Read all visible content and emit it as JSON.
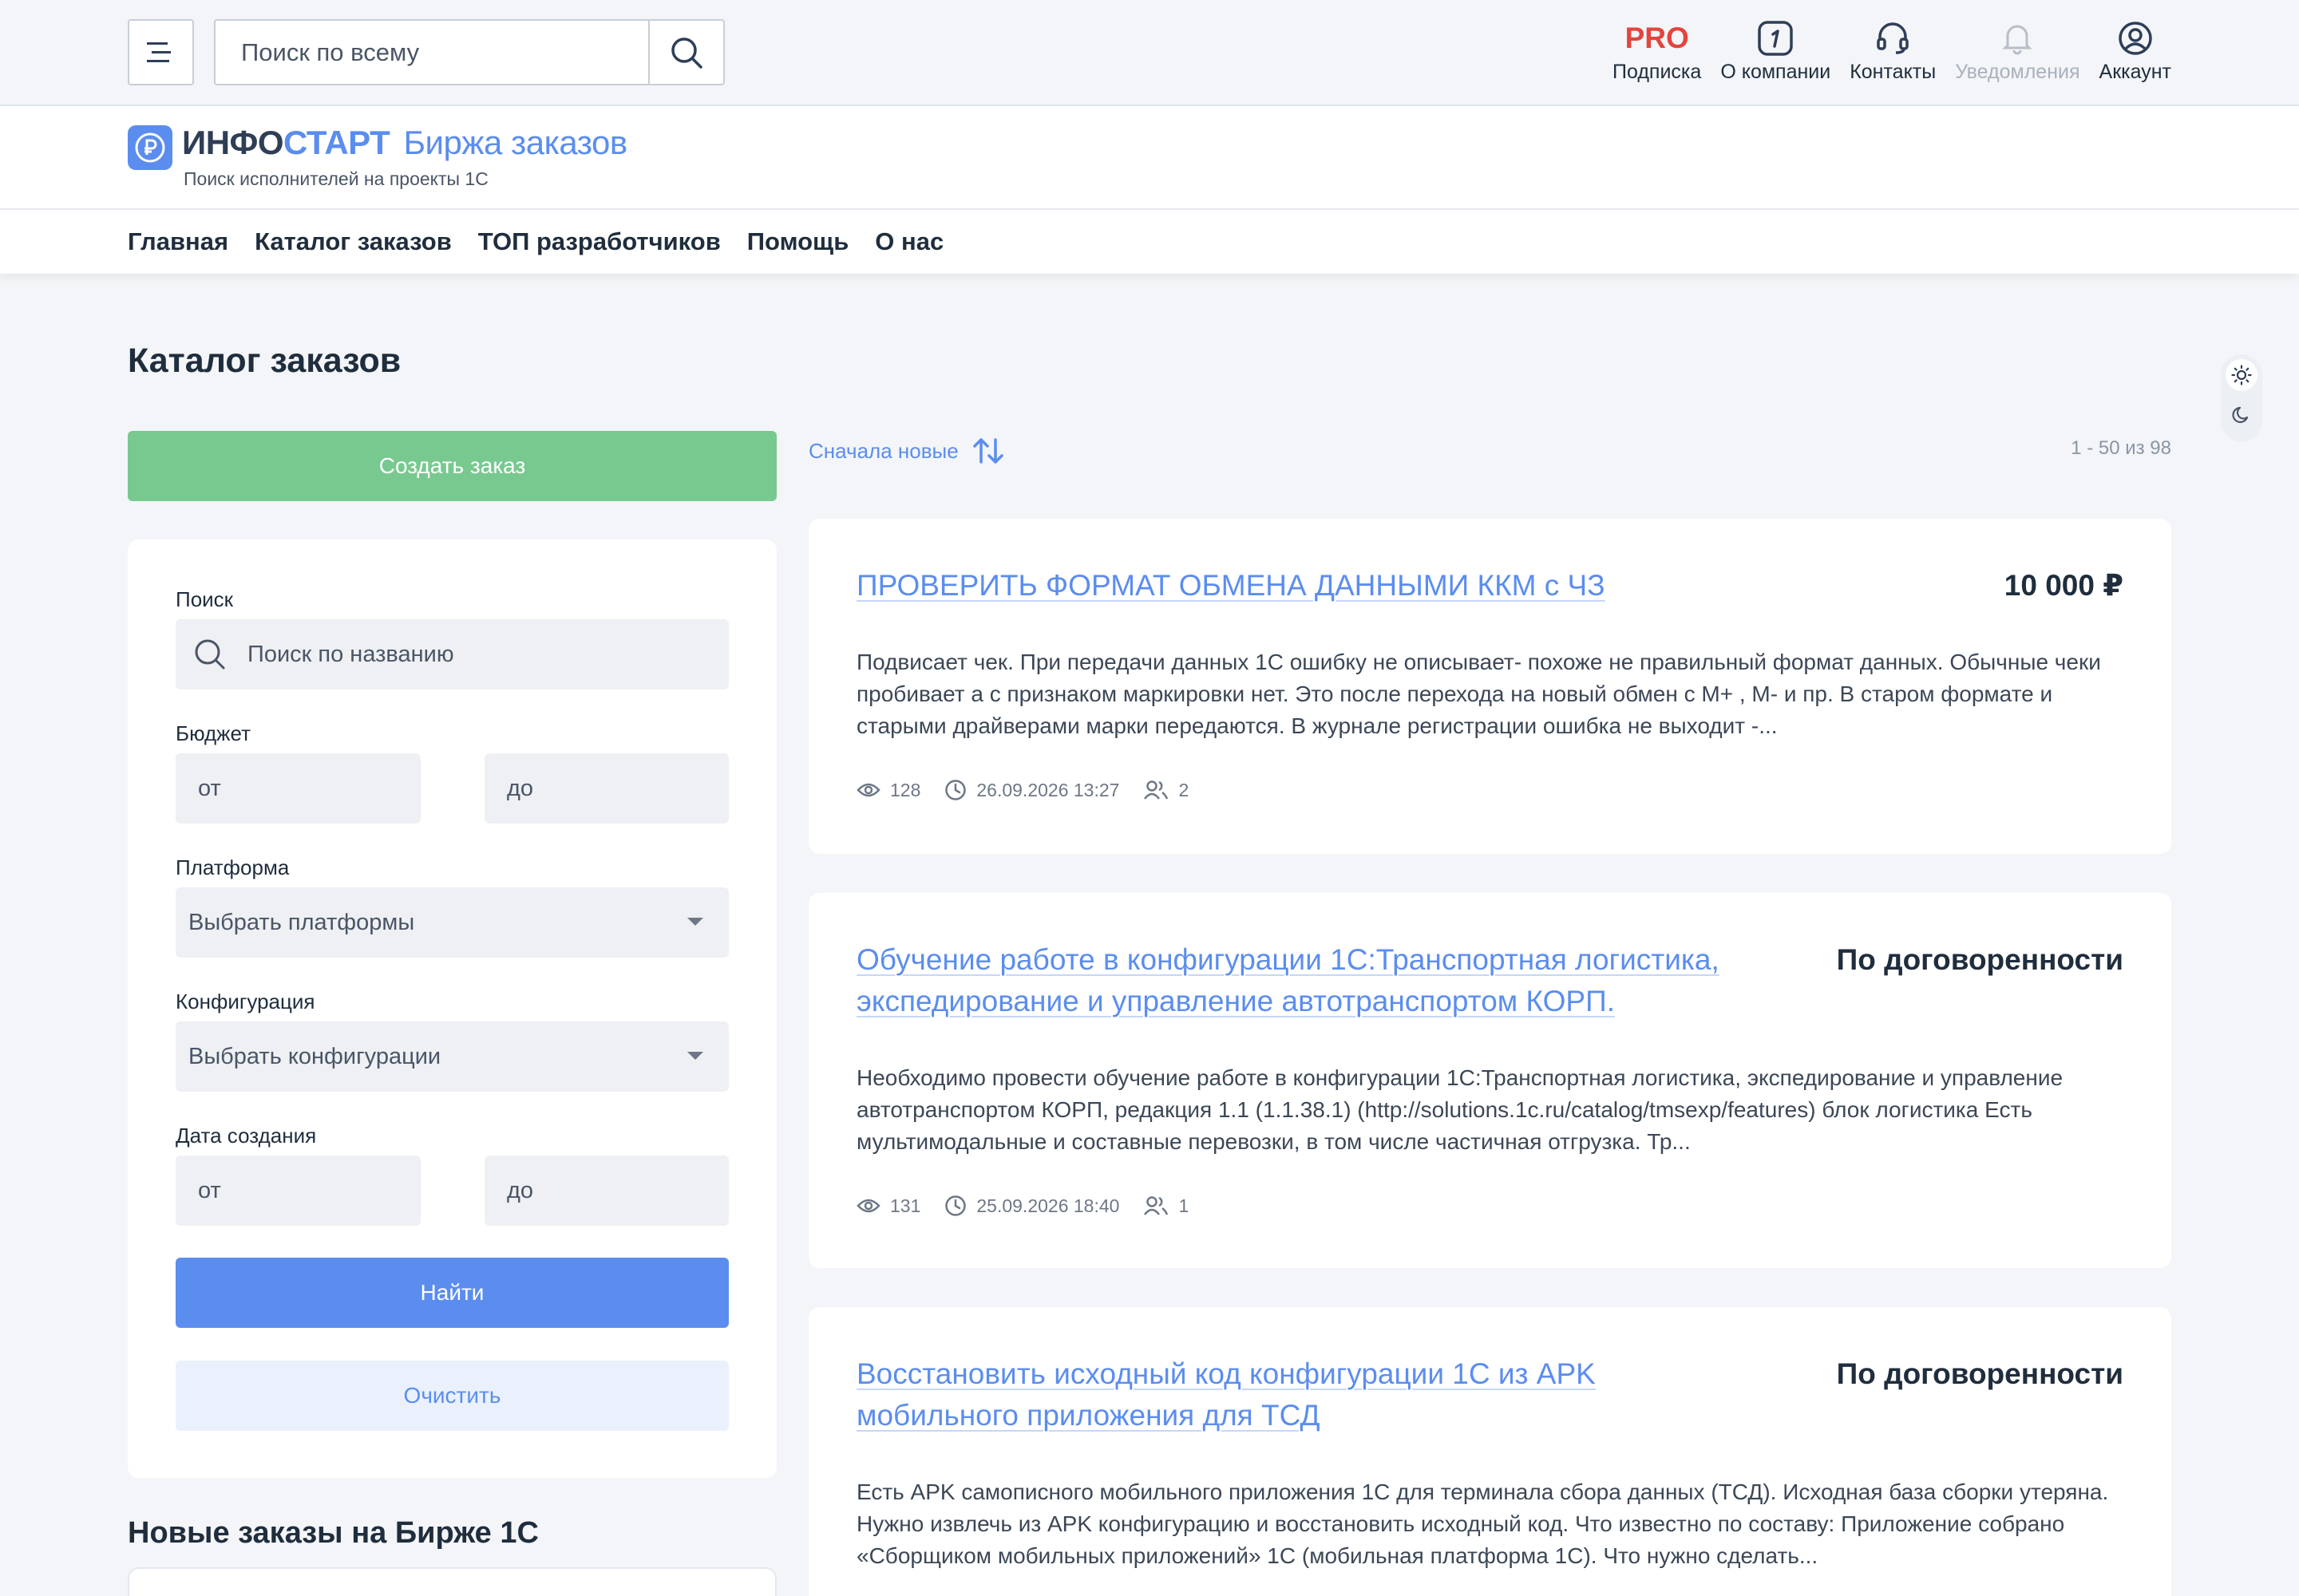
{
  "topbar": {
    "search_placeholder": "Поиск по всему",
    "nav": [
      {
        "id": "pro",
        "top_text": "PRO",
        "label": "Подписка",
        "icon": "pro-text"
      },
      {
        "id": "company",
        "label": "О компании",
        "icon": "infostart-badge-icon"
      },
      {
        "id": "contacts",
        "label": "Контакты",
        "icon": "headset-icon"
      },
      {
        "id": "notifications",
        "label": "Уведомления",
        "icon": "bell-icon",
        "disabled": true
      },
      {
        "id": "account",
        "label": "Аккаунт",
        "icon": "user-circle-icon"
      }
    ]
  },
  "brand": {
    "name_part1": "ИНФО",
    "name_part2": "СТАРТ",
    "subtitle": "Биржа заказов",
    "tagline": "Поиск исполнителей на проекты 1С",
    "logo_symbol": "₽"
  },
  "mainnav": [
    "Главная",
    "Каталог заказов",
    "ТОП разработчиков",
    "Помощь",
    "О нас"
  ],
  "page": {
    "title": "Каталог заказов",
    "create_button": "Создать заказ",
    "sort_label": "Сначала новые",
    "pager_info": "1 - 50 из 98"
  },
  "filters": {
    "search_label": "Поиск",
    "search_placeholder": "Поиск по названию",
    "budget_label": "Бюджет",
    "budget_from": "от",
    "budget_to": "до",
    "platform_label": "Платформа",
    "platform_placeholder": "Выбрать платформы",
    "config_label": "Конфигурация",
    "config_placeholder": "Выбрать конфигурации",
    "date_label": "Дата создания",
    "date_from": "от",
    "date_to": "до",
    "find_button": "Найти",
    "clear_button": "Очистить"
  },
  "new_orders_title": "Новые заказы на Бирже 1С",
  "orders": [
    {
      "title": "ПРОВЕРИТЬ ФОРМАТ ОБМЕНА ДАННЫМИ ККМ с ЧЗ",
      "price": "10 000 ₽",
      "description": "Подвисает чек. При передачи данных 1С ошибку не описывает- похоже не правильный формат данных. Обычные чеки пробивает а с признаком маркировки нет. Это после перехода на новый обмен с М+ , М- и пр. В старом формате и старыми драйверами марки передаются. В журнале регистрации ошибка не выходит -...",
      "views": "128",
      "date": "26.09.2026 13:27",
      "responses": "2"
    },
    {
      "title": "Обучение работе в конфигурации 1С:Транспортная логистика, экспедирование и управление автотранспортом КОРП.",
      "price": "По договоренности",
      "description": "Необходимо провести обучение работе в конфигурации 1С:Транспортная логистика, экспедирование и управление автотранспортом КОРП, редакция 1.1 (1.1.38.1) (http://solutions.1c.ru/catalog/tmsexp/features) блок логистика Есть мультимодальные и составные перевозки, в том числе частичная отгрузка. Тр...",
      "views": "131",
      "date": "25.09.2026 18:40",
      "responses": "1"
    },
    {
      "title": "Восстановить исходный код конфигурации 1С из APK мобильного приложения для ТСД",
      "price": "По договоренности",
      "description": "Есть APK самописного мобильного приложения 1С для терминала сбора данных (ТСД). Исходная база сборки утеряна. Нужно извлечь из APK конфигурацию и восстановить исходный код. Что известно по составу: Приложение собрано «Сборщиком мобильных приложений» 1С (мобильная платформа 1С). Что нужно сделать..."
    }
  ],
  "theme": {
    "active": "light"
  },
  "colors": {
    "accent": "#5b8def",
    "create_button": "#78c98f",
    "pro": "#e2453c",
    "background": "#f3f5f8"
  }
}
